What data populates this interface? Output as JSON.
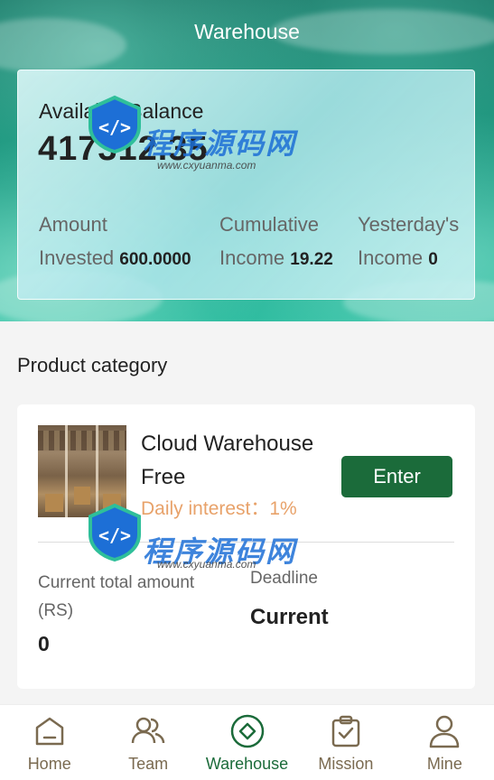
{
  "header": {
    "title": "Warehouse"
  },
  "balance": {
    "label": "Available Balance",
    "value": "417312.35",
    "stats": [
      {
        "label_line1": "Amount",
        "label_line2": "Invested",
        "value": "600.0000"
      },
      {
        "label_line1": "Cumulative",
        "label_line2": "Income",
        "value": "19.22"
      },
      {
        "label_line1": "Yesterday's",
        "label_line2": "Income",
        "value": "0"
      }
    ]
  },
  "section": {
    "title": "Product category"
  },
  "product": {
    "name": "Cloud Warehouse Free",
    "interest": "Daily interest：1%",
    "enter_label": "Enter",
    "amount_label": "Current total amount (RS)",
    "amount_value": "0",
    "deadline_label": "Deadline",
    "deadline_value": "Current"
  },
  "tabbar": {
    "items": [
      {
        "label": "Home",
        "icon": "home-icon"
      },
      {
        "label": "Team",
        "icon": "team-icon"
      },
      {
        "label": "Warehouse",
        "icon": "warehouse-icon",
        "active": true
      },
      {
        "label": "Mission",
        "icon": "mission-icon"
      },
      {
        "label": "Mine",
        "icon": "user-icon"
      }
    ]
  },
  "watermark": {
    "text": "程序源码网",
    "sub": "www.cxyuanma.com"
  },
  "colors": {
    "accent": "#1b6b3a",
    "interest": "#e8a26a",
    "tab_inactive": "#7a6a50"
  }
}
